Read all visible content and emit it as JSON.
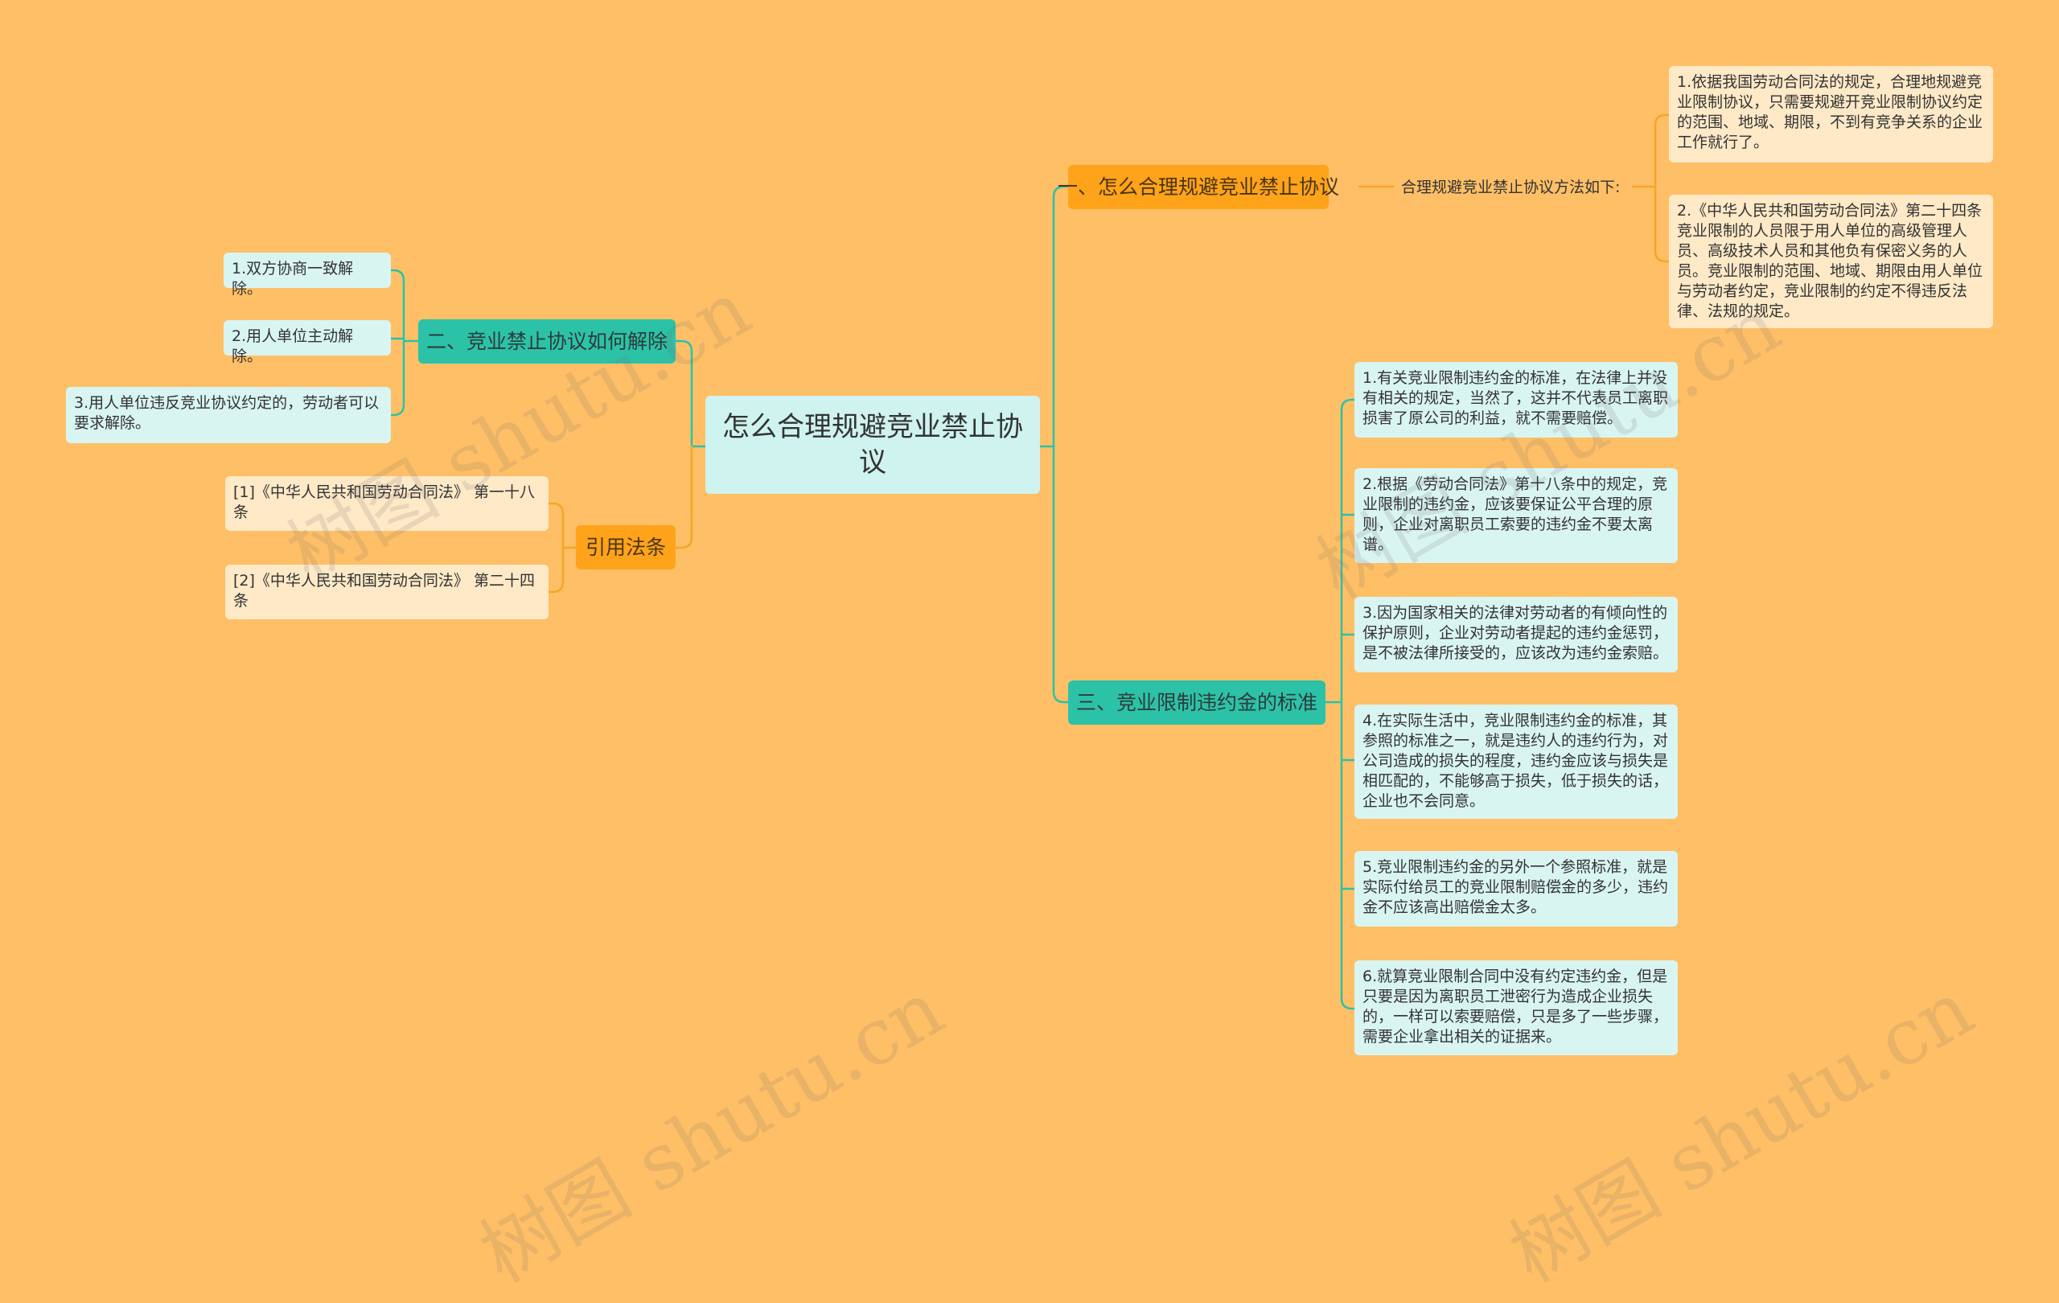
{
  "colors": {
    "background": "#FFBF66",
    "teal_branch": "#2CC2A8",
    "orange_branch": "#FFA31A",
    "leaf_cyan": "#D9F5F2",
    "leaf_cream": "#FFE9C7",
    "link": "#2CC2A8",
    "link_orange": "#F5A623"
  },
  "watermark": "树图 shutu.cn",
  "root": {
    "label": "怎么合理规避竞业禁止协议"
  },
  "branches": {
    "b1": {
      "label": "一、怎么合理规避竞业禁止协议",
      "summary": "合理规避竞业禁止协议方法如下:",
      "items": [
        "1.依据我国劳动合同法的规定，合理地规避竞业限制协议，只需要规避开竞业限制协议约定的范围、地域、期限，不到有竞争关系的企业工作就行了。",
        "2.《中华人民共和国劳动合同法》第二十四条 竞业限制的人员限于用人单位的高级管理人员、高级技术人员和其他负有保密义务的人员。竞业限制的范围、地域、期限由用人单位与劳动者约定，竞业限制的约定不得违反法律、法规的规定。"
      ]
    },
    "b2": {
      "label": "二、竞业禁止协议如何解除",
      "items": [
        "1.双方协商一致解除。",
        "2.用人单位主动解除。",
        "3.用人单位违反竞业协议约定的，劳动者可以要求解除。"
      ]
    },
    "b3": {
      "label": "三、竞业限制违约金的标准",
      "items": [
        "1.有关竞业限制违约金的标准，在法律上并没有相关的规定，当然了，这并不代表员工离职损害了原公司的利益，就不需要赔偿。",
        "2.根据《劳动合同法》第十八条中的规定，竞业限制的违约金，应该要保证公平合理的原则，企业对离职员工索要的违约金不要太离谱。",
        "3.因为国家相关的法律对劳动者的有倾向性的保护原则，企业对劳动者提起的违约金惩罚，是不被法律所接受的，应该改为违约金索赔。",
        "4.在实际生活中，竞业限制违约金的标准，其参照的标准之一，就是违约人的违约行为，对公司造成的损失的程度，违约金应该与损失是相匹配的，不能够高于损失，低于损失的话，企业也不会同意。",
        "5.竞业限制违约金的另外一个参照标准，就是实际付给员工的竞业限制赔偿金的多少，违约金不应该高出赔偿金太多。",
        "6.就算竞业限制合同中没有约定违约金，但是只要是因为离职员工泄密行为造成企业损失的，一样可以索要赔偿，只是多了一些步骤，需要企业拿出相关的证据来。"
      ]
    },
    "b4": {
      "label": "引用法条",
      "items": [
        "[1]《中华人民共和国劳动合同法》 第一十八条",
        "[2]《中华人民共和国劳动合同法》 第二十四条"
      ]
    }
  }
}
